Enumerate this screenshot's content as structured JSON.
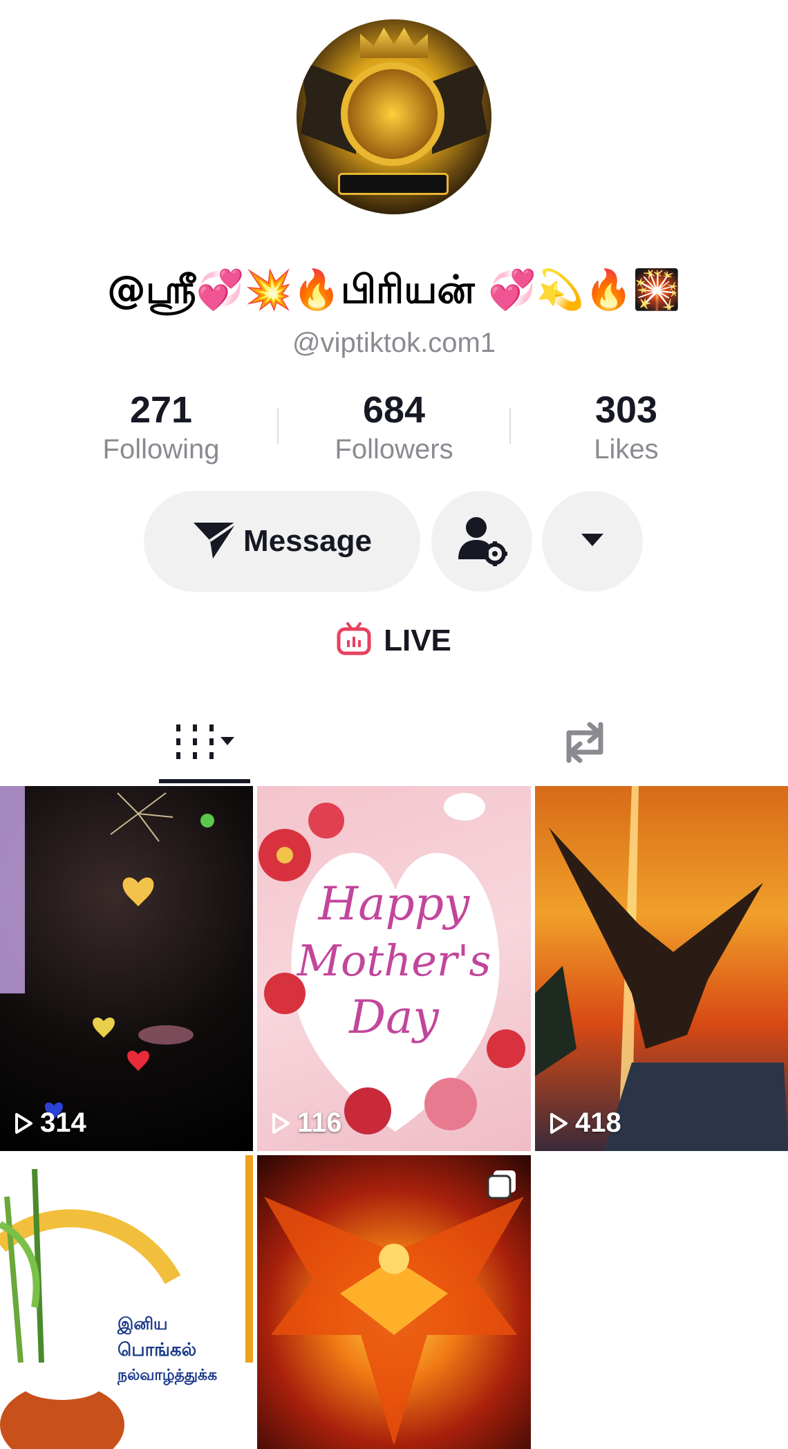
{
  "profile": {
    "display_name": "@ஸ்ரீ💞💥🔥பிரியன் 💞💫🔥🎇",
    "username": "@viptiktok.com1"
  },
  "stats": [
    {
      "value": "271",
      "label": "Following"
    },
    {
      "value": "684",
      "label": "Followers"
    },
    {
      "value": "303",
      "label": "Likes"
    }
  ],
  "actions": {
    "message_label": "Message",
    "live_label": "LIVE"
  },
  "colors": {
    "live_accent": "#e8405f",
    "button_bg": "#f1f1f2",
    "text_primary": "#161823",
    "text_secondary": "#8a8b91"
  },
  "icons": {
    "message": "send-icon",
    "friend_settings": "person-gear-icon",
    "more": "caret-down-icon",
    "live": "tv-icon",
    "videos_tab": "grid-icon",
    "reposts_tab": "repost-icon"
  },
  "videos": [
    {
      "views": "314",
      "theme": "fireworks-hearts"
    },
    {
      "views": "116",
      "theme": "happy-mothers-day",
      "text": [
        "Happy",
        "Mother's",
        "Day"
      ]
    },
    {
      "views": "418",
      "theme": "eagle-sunset"
    },
    {
      "views": "",
      "theme": "pongal",
      "text": [
        "இனிய",
        "பொங்கல்",
        "நல்வாழ்த்துக்க"
      ]
    },
    {
      "views": "",
      "theme": "phoenix",
      "multi_photo": true
    }
  ]
}
